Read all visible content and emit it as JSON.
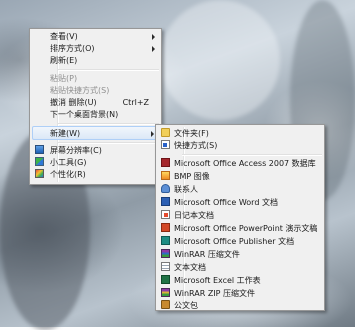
{
  "context_menu": {
    "items": [
      {
        "label": "查看(V)",
        "has_submenu": true
      },
      {
        "label": "排序方式(O)",
        "has_submenu": true
      },
      {
        "label": "刷新(E)"
      },
      {
        "label": "粘贴(P)",
        "disabled": true
      },
      {
        "label": "粘贴快捷方式(S)",
        "disabled": true
      },
      {
        "label": "撤消 删除(U)",
        "shortcut": "Ctrl+Z"
      },
      {
        "label": "下一个桌面背景(N)"
      },
      {
        "label": "新建(W)",
        "has_submenu": true,
        "highlighted": true
      },
      {
        "label": "屏幕分辨率(C)",
        "icon": "display-icon"
      },
      {
        "label": "小工具(G)",
        "icon": "gadgets-icon"
      },
      {
        "label": "个性化(R)",
        "icon": "personalize-icon"
      }
    ]
  },
  "new_submenu": {
    "items": [
      {
        "label": "文件夹(F)",
        "icon": "folder-icon"
      },
      {
        "label": "快捷方式(S)",
        "icon": "shortcut-icon"
      },
      {
        "label": "Microsoft Office Access 2007 数据库",
        "icon": "access-icon"
      },
      {
        "label": "BMP 图像",
        "icon": "bmp-icon"
      },
      {
        "label": "联系人",
        "icon": "contact-icon"
      },
      {
        "label": "Microsoft Office Word 文档",
        "icon": "word-icon"
      },
      {
        "label": "日记本文档",
        "icon": "journal-icon"
      },
      {
        "label": "Microsoft Office PowerPoint 演示文稿",
        "icon": "powerpoint-icon"
      },
      {
        "label": "Microsoft Office Publisher 文档",
        "icon": "publisher-icon"
      },
      {
        "label": "WinRAR 压缩文件",
        "icon": "winrar-icon"
      },
      {
        "label": "文本文档",
        "icon": "text-doc-icon"
      },
      {
        "label": "Microsoft Excel 工作表",
        "icon": "excel-icon"
      },
      {
        "label": "WinRAR ZIP 压缩文件",
        "icon": "winrar-zip-icon"
      },
      {
        "label": "公文包",
        "icon": "briefcase-icon"
      }
    ]
  },
  "colors": {
    "menu_bg": "#f0f0f0",
    "highlight": "#dbe8f7",
    "disabled_text": "#8f8f8f"
  }
}
